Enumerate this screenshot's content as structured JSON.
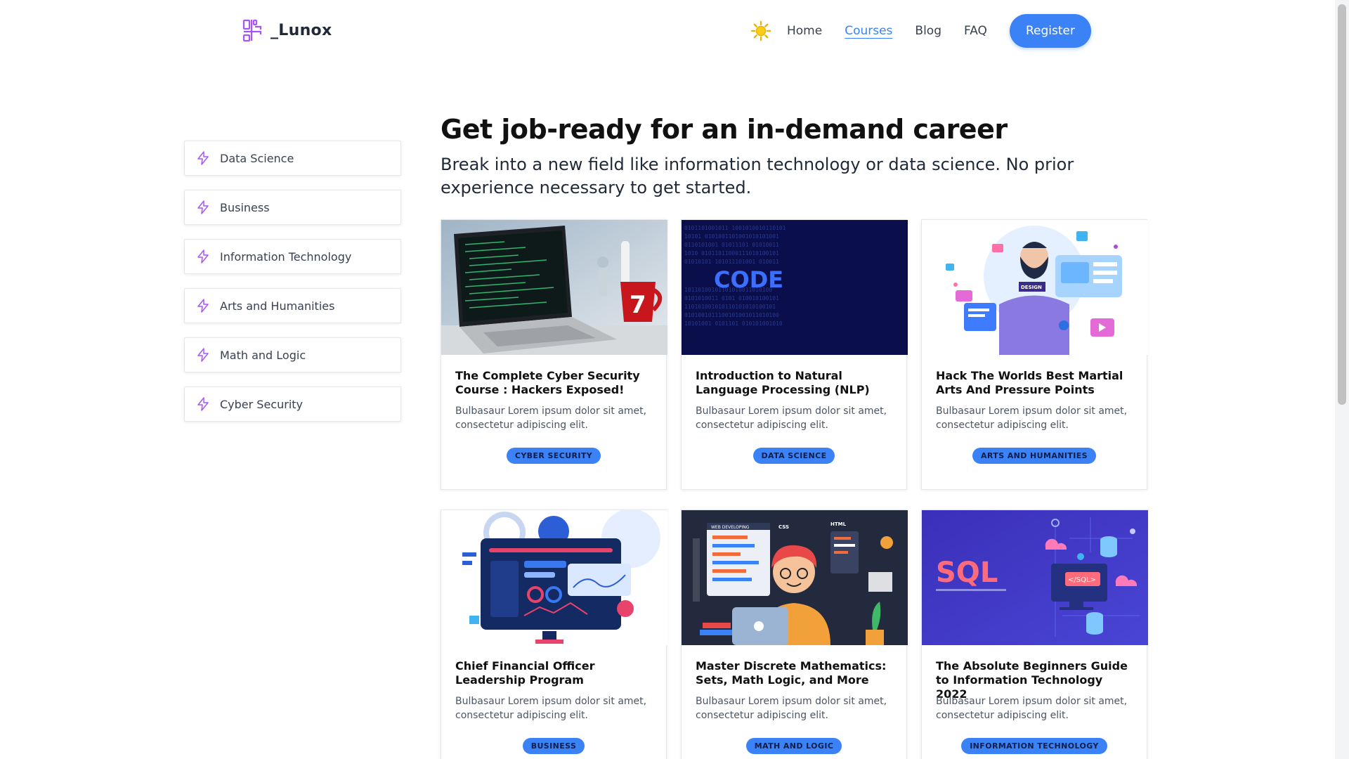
{
  "brand": {
    "name": "_Lunox",
    "accent": "#3b82f6",
    "icon_accent": "#a855f7"
  },
  "nav": {
    "theme_toggle_icon": "sun-icon",
    "links": [
      "Home",
      "Courses",
      "Blog",
      "FAQ"
    ],
    "active": "Courses",
    "register_label": "Register"
  },
  "sidebar": {
    "icon": "lightning-icon",
    "items": [
      {
        "label": "Data Science"
      },
      {
        "label": "Business"
      },
      {
        "label": "Information Technology"
      },
      {
        "label": "Arts and Humanities"
      },
      {
        "label": "Math and Logic"
      },
      {
        "label": "Cyber Security"
      }
    ]
  },
  "main": {
    "headline": "Get job-ready for an in-demand career",
    "subhead": "Break into a new field like information technology or data science. No prior experience necessary to get started."
  },
  "courses": [
    {
      "title": "The Complete Cyber Security Course : Hackers Exposed!",
      "desc": "Bulbasaur Lorem ipsum dolor sit amet, consectetur adipiscing elit.",
      "tag": "CYBER SECURITY",
      "image": "laptop-code-photo"
    },
    {
      "title": "Introduction to Natural Language Processing (NLP)",
      "desc": "Bulbasaur Lorem ipsum dolor sit amet, consectetur adipiscing elit.",
      "tag": "DATA SCIENCE",
      "image": "code-binary-illustration",
      "image_text": "CODE"
    },
    {
      "title": "Hack The Worlds Best Martial Arts And Pressure Points",
      "desc": "Bulbasaur Lorem ipsum dolor sit amet, consectetur adipiscing elit.",
      "tag": "ARTS AND HUMANITIES",
      "image": "designer-illustration",
      "image_text": "DESIGN"
    },
    {
      "title": "Chief Financial Officer Leadership Program",
      "desc": "Bulbasaur Lorem ipsum dolor sit amet, consectetur adipiscing elit.",
      "tag": "BUSINESS",
      "image": "dashboard-illustration"
    },
    {
      "title": "Master Discrete Mathematics: Sets, Math Logic, and More",
      "desc": "Bulbasaur Lorem ipsum dolor sit amet, consectetur adipiscing elit.",
      "tag": "MATH AND LOGIC",
      "image": "web-developer-illustration",
      "image_text": [
        "WEB DEVELOPING",
        "CSS",
        "HTML"
      ]
    },
    {
      "title": "The Absolute Beginners Guide to Information Technology 2022",
      "desc": "Bulbasaur Lorem ipsum dolor sit amet, consectetur adipiscing elit.",
      "tag": "INFORMATION TECHNOLOGY",
      "image": "sql-database-illustration",
      "image_text": [
        "SQL",
        "</SQL>"
      ]
    }
  ]
}
